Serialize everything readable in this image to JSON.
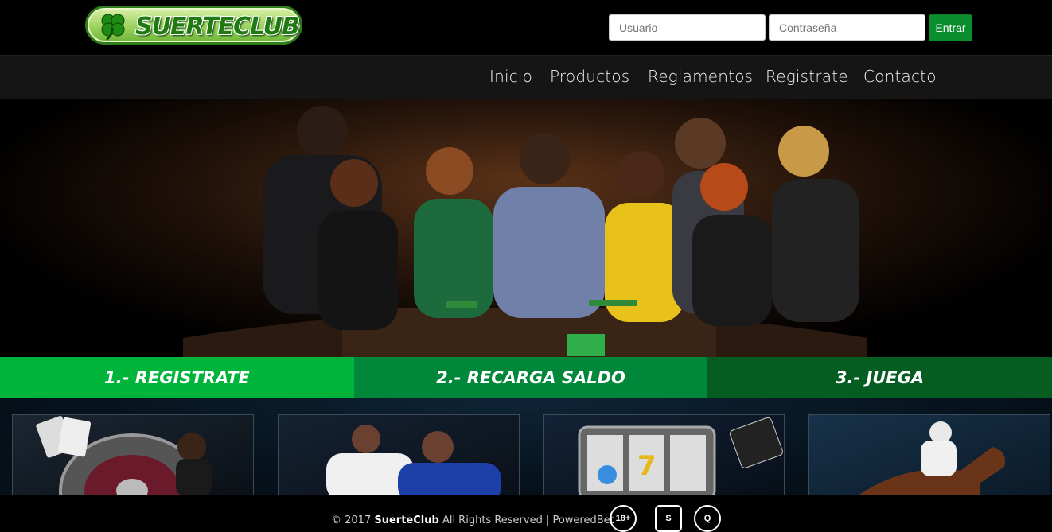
{
  "brand": {
    "name": "SUERTECLUB",
    "clover_icon": "clover-icon"
  },
  "login": {
    "user_placeholder": "Usuario",
    "pass_placeholder": "Contraseña",
    "enter_label": "Entrar"
  },
  "nav": {
    "items": [
      "Inicio",
      "Productos",
      "Reglamentos",
      "Registrate",
      "Contacto"
    ]
  },
  "steps": [
    {
      "label": "1.- REGISTRATE",
      "color": "#00b43b"
    },
    {
      "label": "2.- RECARGA SALDO",
      "color": "#00873a"
    },
    {
      "label": "3.- JUEGA",
      "color": "#055d22"
    }
  ],
  "products": [
    {
      "name": "casino-roulette-card",
      "icon": "roulette-icon"
    },
    {
      "name": "sports-football-card",
      "icon": "football-icon"
    },
    {
      "name": "slots-card",
      "icon": "slot-machine-icon"
    },
    {
      "name": "horse-racing-card",
      "icon": "horse-icon"
    }
  ],
  "footer": {
    "year": "© 2017",
    "site": "SuerteClub",
    "rights": "All Rights Reserved | PoweredBet",
    "badges": [
      "18+",
      "S",
      "Q"
    ]
  },
  "colors": {
    "accent": "#0b8f2e",
    "nav_bg": "#151515"
  }
}
